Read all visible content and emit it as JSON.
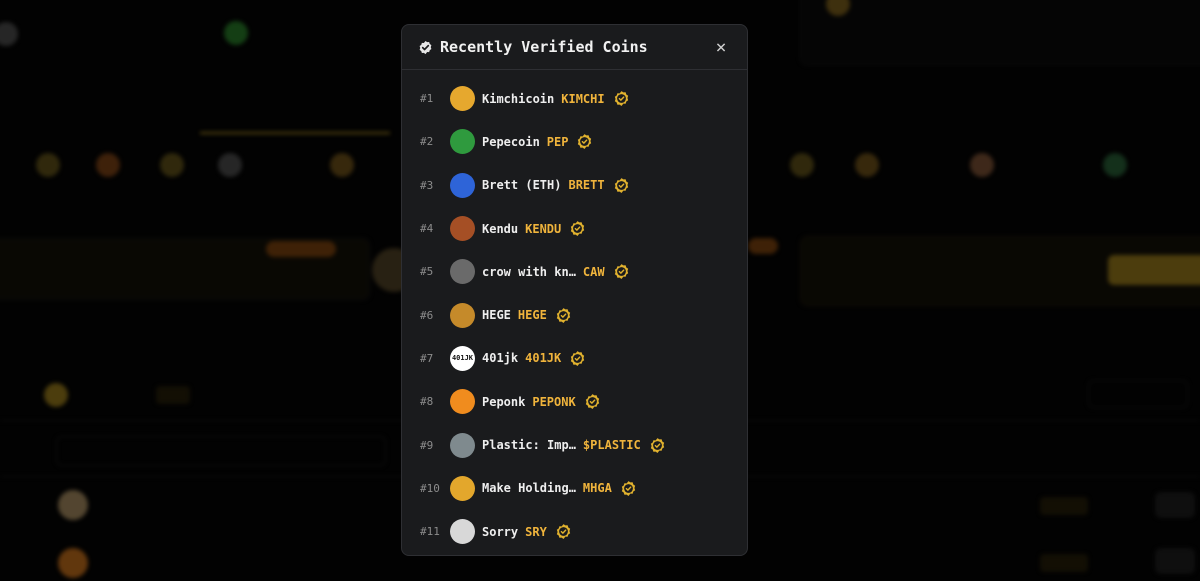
{
  "modal": {
    "title": "Recently Verified Coins",
    "close_icon": "×",
    "items": [
      {
        "rank": "#1",
        "name": "Kimchicoin",
        "ticker": "KIMCHI",
        "avatar_color": "#e6a82e",
        "avatar_text": ""
      },
      {
        "rank": "#2",
        "name": "Pepecoin",
        "ticker": "PEP",
        "avatar_color": "#2f9a3e",
        "avatar_text": ""
      },
      {
        "rank": "#3",
        "name": "Brett (ETH)",
        "ticker": "BRETT",
        "avatar_color": "#2e64d8",
        "avatar_text": ""
      },
      {
        "rank": "#4",
        "name": "Kendu",
        "ticker": "KENDU",
        "avatar_color": "#a54f25",
        "avatar_text": ""
      },
      {
        "rank": "#5",
        "name": "crow with kn…",
        "ticker": "CAW",
        "avatar_color": "#6a6a6a",
        "avatar_text": ""
      },
      {
        "rank": "#6",
        "name": "HEGE",
        "ticker": "HEGE",
        "avatar_color": "#c58a2a",
        "avatar_text": ""
      },
      {
        "rank": "#7",
        "name": "401jk",
        "ticker": "401JK",
        "avatar_color": "#ffffff",
        "avatar_text": "401JK"
      },
      {
        "rank": "#8",
        "name": "Peponk",
        "ticker": "PEPONK",
        "avatar_color": "#f08c1e",
        "avatar_text": ""
      },
      {
        "rank": "#9",
        "name": "Plastic: Imp…",
        "ticker": "$PLASTIC",
        "avatar_color": "#7f8a8e",
        "avatar_text": ""
      },
      {
        "rank": "#10",
        "name": "Make Holding…",
        "ticker": "MHGA",
        "avatar_color": "#e3a72c",
        "avatar_text": ""
      },
      {
        "rank": "#11",
        "name": "Sorry",
        "ticker": "SRY",
        "avatar_color": "#d8d8d8",
        "avatar_text": ""
      }
    ]
  },
  "colors": {
    "accent": "#f0b43c",
    "modal_bg": "#1a1b1d",
    "border": "#2e2f33"
  }
}
